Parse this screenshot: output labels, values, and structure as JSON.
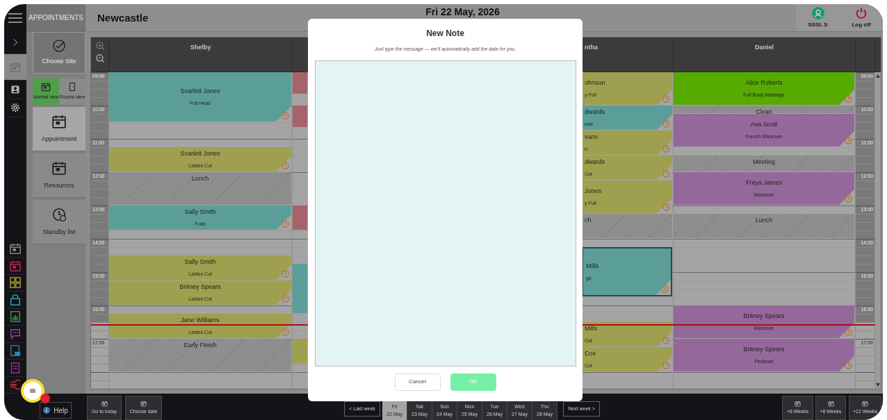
{
  "app": {
    "section": "APPOINTMENTS",
    "location": "Newcastle",
    "date": "Fri 22 May, 2026",
    "user": "SSSL S",
    "logoff": "Log off"
  },
  "rail": [
    {
      "selected": false
    },
    {
      "selected": true
    },
    {
      "selected": false
    },
    {
      "selected": false
    }
  ],
  "sidebar": {
    "choose_site": "Choose Site",
    "views": [
      {
        "label": "Normal view",
        "selected": true
      },
      {
        "label": "Rooms view",
        "selected": false
      }
    ],
    "items": [
      {
        "label": "Appointment",
        "selected": true
      },
      {
        "label": "Resources",
        "selected": false
      },
      {
        "label": "Standby list",
        "selected": false
      }
    ]
  },
  "calendar": {
    "time_labels_left": [
      "09:00",
      "10:00",
      "11:00",
      "12:00",
      "13:00",
      "14:00",
      "15:00",
      "16:00",
      "17:00"
    ],
    "time_labels_right": [
      "09:00",
      "10:00",
      "11:00",
      "12:00",
      "13:00",
      "14:00",
      "15:00",
      "16:00",
      "17:00"
    ],
    "columns": [
      {
        "kind": "full",
        "name": "Shelby",
        "appointments": [
          {
            "kind": "appointment",
            "client": "Scarlett Jones",
            "service": "Full Head",
            "color": "#5b9e99",
            "selected": false
          },
          {
            "kind": "appointment",
            "client": "Scarlett Jones",
            "service": "Ladies Cut",
            "color": "#9fa04f",
            "selected": false
          },
          {
            "kind": "block",
            "label": "Lunch",
            "selected": false
          },
          {
            "kind": "appointment",
            "client": "Sally Smith",
            "service": "Foils",
            "color": "#5b9e99",
            "selected": false
          },
          {
            "kind": "appointment",
            "client": "Sally Smith",
            "service": "Ladies Cut",
            "color": "#9fa04f",
            "selected": false
          },
          {
            "kind": "appointment",
            "client": "Britney Spears",
            "service": "Ladies Cut",
            "color": "#9fa04f",
            "selected": false
          },
          {
            "kind": "appointment",
            "client": "Jane Williams",
            "service": "Ladies Cut",
            "color": "#9fa04f",
            "selected": false
          },
          {
            "kind": "block",
            "label": "Early Finish",
            "selected": false
          }
        ]
      },
      {
        "kind": "strip",
        "appointments": [
          {
            "kind": "appointment",
            "color": "#a7636a",
            "selected": false
          },
          {
            "kind": "appointment",
            "color": "#a7636a",
            "selected": false
          },
          {
            "kind": "appointment",
            "color": "#a7636a",
            "selected": false
          },
          {
            "kind": "appointment",
            "color": "#5b9e99",
            "selected": false
          },
          {
            "kind": "appointment",
            "color": "#9fa04f",
            "selected": false
          }
        ]
      },
      {
        "kind": "cut",
        "name": "ntha",
        "appointments": [
          {
            "kind": "appointment",
            "client": "ohnson",
            "service": "y Full",
            "color": "#9fa04f",
            "selected": false
          },
          {
            "kind": "appointment",
            "client": "dwards",
            "service": "ead",
            "color": "#5b9e99",
            "selected": false
          },
          {
            "kind": "appointment",
            "client": "vans",
            "service": "n",
            "color": "#9fa04f",
            "selected": false
          },
          {
            "kind": "appointment",
            "client": "dwards",
            "service": "Cut",
            "color": "#9fa04f",
            "selected": false
          },
          {
            "kind": "appointment",
            "client": "Jones",
            "service": "y Full",
            "color": "#9fa04f",
            "selected": false
          },
          {
            "kind": "block",
            "label": "ch",
            "selected": false
          },
          {
            "kind": "appointment",
            "client": "Mills",
            "service": "ge",
            "color": "#5b9e99",
            "selected": true
          },
          {
            "kind": "appointment",
            "client": "Mills",
            "service": "Cut",
            "color": "#9fa04f",
            "selected": false
          },
          {
            "kind": "appointment",
            "client": "Cox",
            "service": "Cut",
            "color": "#9fa04f",
            "selected": false
          }
        ]
      },
      {
        "kind": "full",
        "name": "Daniel",
        "appointments": [
          {
            "kind": "appointment",
            "client": "Alice Roberts",
            "service": "Full Body Massage",
            "color": "#56aa00",
            "selected": false
          },
          {
            "kind": "block",
            "label": "Clean",
            "selected": false
          },
          {
            "kind": "appointment",
            "client": "Ava Scott",
            "service": "French Manicure",
            "color": "#95689b",
            "selected": false
          },
          {
            "kind": "block",
            "label": "Meeting",
            "selected": false
          },
          {
            "kind": "appointment",
            "client": "Freya James",
            "service": "Manicure",
            "color": "#95689b",
            "selected": false
          },
          {
            "kind": "block",
            "label": "Lunch",
            "selected": false
          },
          {
            "kind": "appointment",
            "client": "Britney Spears",
            "service": "Manicure",
            "color": "#95689b",
            "selected": false
          },
          {
            "kind": "appointment",
            "client": "Britney Spears",
            "service": "Pedicure",
            "color": "#95689b",
            "selected": false
          }
        ]
      }
    ]
  },
  "bottom_bar": {
    "help": "Help",
    "left_buttons": [
      "Go to today",
      "Choose date"
    ],
    "last_week": "< Last week",
    "next_week": "Next week >",
    "days": [
      {
        "day": "Fri",
        "date": "22 May",
        "selected": true
      },
      {
        "day": "Sat",
        "date": "23 May",
        "selected": false
      },
      {
        "day": "Sun",
        "date": "24 May",
        "selected": false
      },
      {
        "day": "Mon",
        "date": "25 May",
        "selected": false
      },
      {
        "day": "Tue",
        "date": "26 May",
        "selected": false
      },
      {
        "day": "Wed",
        "date": "27 May",
        "selected": false
      },
      {
        "day": "Thu",
        "date": "28 May",
        "selected": false
      }
    ],
    "right_buttons": [
      "+6 Weeks",
      "+8 Weeks",
      "+12 Weeks"
    ]
  },
  "dialog": {
    "title": "New Note",
    "subtitle": "Just type the message — we'll automatically add the date for you.",
    "buttons": [
      {
        "label": "Cancel",
        "kind": "secondary"
      },
      {
        "label": "OK",
        "kind": "primary"
      }
    ]
  }
}
